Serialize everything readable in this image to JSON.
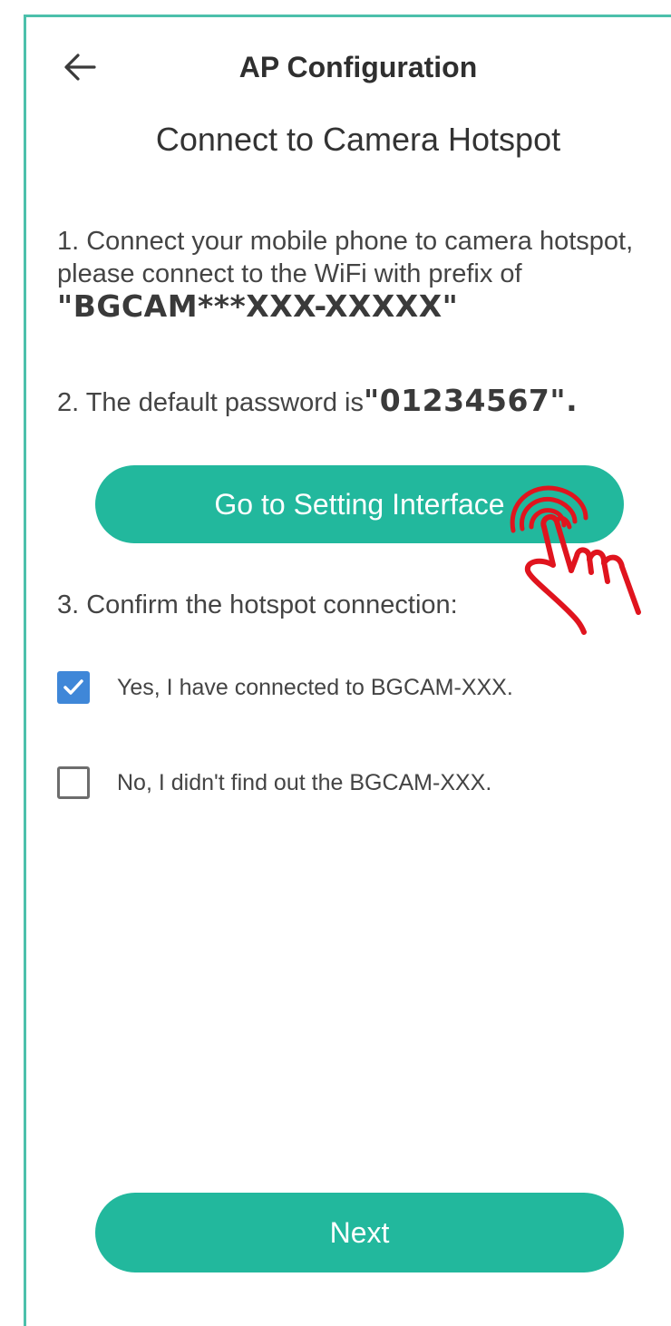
{
  "header": {
    "title": "AP Configuration",
    "back_icon": "arrow-left-icon"
  },
  "subtitle": "Connect to Camera Hotspot",
  "steps": {
    "step1_text": "1. Connect your mobile phone to camera hotspot, please connect to the WiFi with prefix of ",
    "step1_value": "\"BGCAM***XXX-XXXXX\"",
    "step2_text": "2.  The default password is",
    "step2_value": "\"01234567\".",
    "step3_text": "3. Confirm the hotspot connection:"
  },
  "setting_button": {
    "label": "Go to Setting Interface"
  },
  "options": [
    {
      "label": "Yes, I have connected to BGCAM-XXX.",
      "checked": true
    },
    {
      "label": "No, I didn't find out the BGCAM-XXX.",
      "checked": false
    }
  ],
  "next_button": {
    "label": "Next"
  },
  "colors": {
    "accent": "#22b89d",
    "frame": "#4cc0ab",
    "checkbox_checked": "#3f87d8",
    "hand_annotation": "#e0141e"
  },
  "annotation_icon": "tap-hand-icon"
}
